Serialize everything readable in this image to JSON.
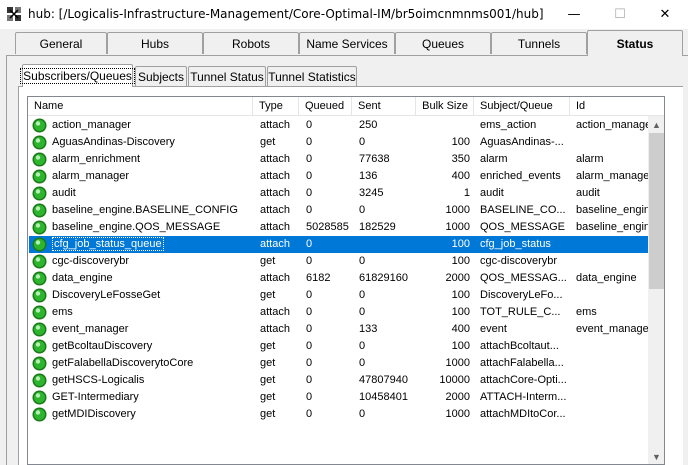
{
  "window": {
    "title": "hub: [/Logicalis-Infrastructure-Management/Core-Optimal-IM/br5oimcnmnms001/hub]",
    "minimize": "—",
    "maximize": "☐",
    "close": "✕"
  },
  "top_tabs": [
    {
      "label": "General"
    },
    {
      "label": "Hubs"
    },
    {
      "label": "Robots"
    },
    {
      "label": "Name Services"
    },
    {
      "label": "Queues"
    },
    {
      "label": "Tunnels"
    },
    {
      "label": "Status",
      "active": true
    }
  ],
  "sub_tabs": [
    {
      "label": "Subscribers/Queues",
      "active": true
    },
    {
      "label": "Subjects"
    },
    {
      "label": "Tunnel Status"
    },
    {
      "label": "Tunnel Statistics"
    }
  ],
  "columns": [
    "Name",
    "Type",
    "Queued",
    "Sent",
    "Bulk Size",
    "Subject/Queue",
    "Id"
  ],
  "rows": [
    {
      "name": "action_manager",
      "type": "attach",
      "queued": "0",
      "sent": "250",
      "bulk": "",
      "subject": "ems_action",
      "id": "action_manage"
    },
    {
      "name": "AguasAndinas-Discovery",
      "type": "get",
      "queued": "0",
      "sent": "0",
      "bulk": "100",
      "subject": "AguasAndinas-...",
      "id": ""
    },
    {
      "name": "alarm_enrichment",
      "type": "attach",
      "queued": "0",
      "sent": "77638",
      "bulk": "350",
      "subject": "alarm",
      "id": "alarm"
    },
    {
      "name": "alarm_manager",
      "type": "attach",
      "queued": "0",
      "sent": "136",
      "bulk": "400",
      "subject": "enriched_events",
      "id": "alarm_manager"
    },
    {
      "name": "audit",
      "type": "attach",
      "queued": "0",
      "sent": "3245",
      "bulk": "1",
      "subject": "audit",
      "id": "audit"
    },
    {
      "name": "baseline_engine.BASELINE_CONFIG",
      "type": "attach",
      "queued": "0",
      "sent": "0",
      "bulk": "1000",
      "subject": "BASELINE_CO...",
      "id": "baseline_engin"
    },
    {
      "name": "baseline_engine.QOS_MESSAGE",
      "type": "attach",
      "queued": "5028585",
      "sent": "182529",
      "bulk": "1000",
      "subject": "QOS_MESSAGE",
      "id": "baseline_engin"
    },
    {
      "name": "cfg_job_status_queue",
      "type": "attach",
      "queued": "0",
      "sent": "",
      "bulk": "100",
      "subject": "cfg_job_status",
      "id": "",
      "selected": true
    },
    {
      "name": "cgc-discoverybr",
      "type": "get",
      "queued": "0",
      "sent": "0",
      "bulk": "100",
      "subject": "cgc-discoverybr",
      "id": ""
    },
    {
      "name": "data_engine",
      "type": "attach",
      "queued": "6182",
      "sent": "61829160",
      "bulk": "2000",
      "subject": "QOS_MESSAG...",
      "id": "data_engine"
    },
    {
      "name": "DiscoveryLeFosseGet",
      "type": "get",
      "queued": "0",
      "sent": "0",
      "bulk": "100",
      "subject": "DiscoveryLeFo...",
      "id": ""
    },
    {
      "name": "ems",
      "type": "attach",
      "queued": "0",
      "sent": "0",
      "bulk": "100",
      "subject": "TOT_RULE_C...",
      "id": "ems"
    },
    {
      "name": "event_manager",
      "type": "attach",
      "queued": "0",
      "sent": "133",
      "bulk": "400",
      "subject": "event",
      "id": "event_manage"
    },
    {
      "name": "getBcoltauDiscovery",
      "type": "get",
      "queued": "0",
      "sent": "0",
      "bulk": "100",
      "subject": "attachBcoltaut...",
      "id": ""
    },
    {
      "name": "getFalabellaDiscoverytoCore",
      "type": "get",
      "queued": "0",
      "sent": "0",
      "bulk": "1000",
      "subject": "attachFalabella...",
      "id": ""
    },
    {
      "name": "getHSCS-Logicalis",
      "type": "get",
      "queued": "0",
      "sent": "47807940",
      "bulk": "10000",
      "subject": "attachCore-Opti...",
      "id": ""
    },
    {
      "name": "GET-Intermediary",
      "type": "get",
      "queued": "0",
      "sent": "10458401",
      "bulk": "2000",
      "subject": "ATTACH-Interm...",
      "id": ""
    },
    {
      "name": "getMDIDiscovery",
      "type": "get",
      "queued": "0",
      "sent": "0",
      "bulk": "1000",
      "subject": "attachMDItoCor...",
      "id": ""
    }
  ],
  "colors": {
    "selection": "#0078d7",
    "status_green": "#2db52d"
  }
}
